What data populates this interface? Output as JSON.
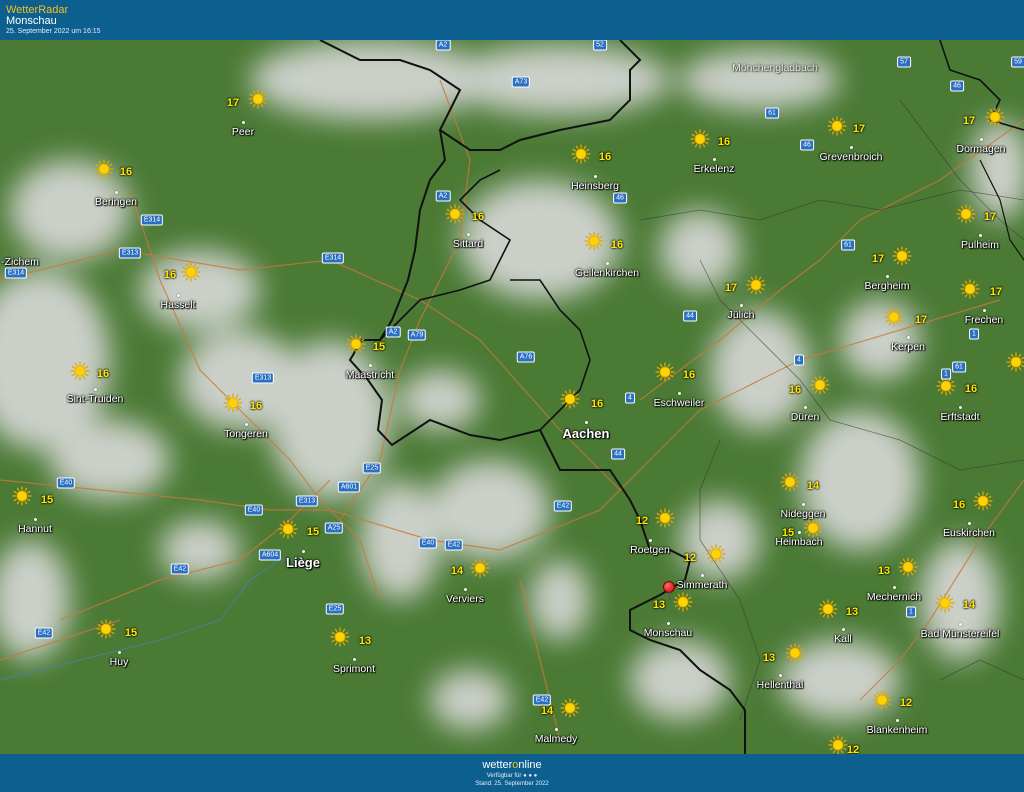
{
  "header": {
    "app_name": "WetterRadar",
    "location": "Monschau",
    "timestamp": "25. September 2022 um 16:15"
  },
  "footer": {
    "logo_part1": "wetter",
    "logo_part2": "o",
    "logo_part3": "nline",
    "availability": "Verfügbar für",
    "stand": "Stand: 25. September 2022"
  },
  "colors": {
    "bar": "#0c5f8f",
    "land": "#4b7a35",
    "cloud": "#d8d8d8",
    "border": "#111111",
    "roads": "#c9783a",
    "temp": "#ffe800"
  },
  "cities": [
    {
      "name": "Peer",
      "temp": "17"
    },
    {
      "name": "Beringen",
      "temp": "16"
    },
    {
      "name": "-Zichem",
      "temp": ""
    },
    {
      "name": "Hasselt",
      "temp": "16"
    },
    {
      "name": "Sint-Truiden",
      "temp": "16"
    },
    {
      "name": "Tongeren",
      "temp": "16"
    },
    {
      "name": "Hannut",
      "temp": "15"
    },
    {
      "name": "Huy",
      "temp": "15"
    },
    {
      "name": "Liège",
      "temp": "15"
    },
    {
      "name": "Sprimont",
      "temp": "13"
    },
    {
      "name": "Verviers",
      "temp": "14"
    },
    {
      "name": "Malmedy",
      "temp": "14"
    },
    {
      "name": "Maastricht",
      "temp": "15"
    },
    {
      "name": "Sittard",
      "temp": "16"
    },
    {
      "name": "Heinsberg",
      "temp": "16"
    },
    {
      "name": "Geilenkirchen",
      "temp": "16"
    },
    {
      "name": "Aachen",
      "temp": "16"
    },
    {
      "name": "Eschweiler",
      "temp": "16"
    },
    {
      "name": "Erkelenz",
      "temp": "16"
    },
    {
      "name": "Jülich",
      "temp": "17"
    },
    {
      "name": "Düren",
      "temp": "16"
    },
    {
      "name": "Roetgen",
      "temp": "12"
    },
    {
      "name": "Simmerath",
      "temp": "12"
    },
    {
      "name": "Monschau",
      "temp": "13"
    },
    {
      "name": "Nideggen",
      "temp": "14"
    },
    {
      "name": "Heimbach",
      "temp": "15"
    },
    {
      "name": "Hellenthal",
      "temp": "13"
    },
    {
      "name": "Kall",
      "temp": "13"
    },
    {
      "name": "Mechernich",
      "temp": "13"
    },
    {
      "name": "Bad Münstereifel",
      "temp": "14"
    },
    {
      "name": "Blankenheim",
      "temp": "12"
    },
    {
      "name": "Euskirchen",
      "temp": "16"
    },
    {
      "name": "Erftstadt",
      "temp": "16"
    },
    {
      "name": "Kerpen",
      "temp": "17"
    },
    {
      "name": "Frechen",
      "temp": "17"
    },
    {
      "name": "Bergheim",
      "temp": "17"
    },
    {
      "name": "Pulheim",
      "temp": "17"
    },
    {
      "name": "Grevenbroich",
      "temp": "17"
    },
    {
      "name": "Dormagen",
      "temp": "17"
    },
    {
      "name": "Mönchengladbach",
      "temp": ""
    },
    {
      "name": "Geilenkirchen-top",
      "temp": ""
    }
  ],
  "extra_temps": [
    "12",
    "16"
  ],
  "roads": [
    "A2",
    "A73",
    "52",
    "57",
    "46",
    "59",
    "61",
    "46",
    "E314",
    "E313",
    "E314",
    "A2",
    "E314",
    "E313",
    "A2",
    "A79",
    "A76",
    "46",
    "61",
    "44",
    "4",
    "4",
    "1",
    "61",
    "E40",
    "E25",
    "A601",
    "E313",
    "E40",
    "A25",
    "A604",
    "E42",
    "E40",
    "E42",
    "E42",
    "E25",
    "E42",
    "44",
    "1",
    "1",
    "E42"
  ]
}
